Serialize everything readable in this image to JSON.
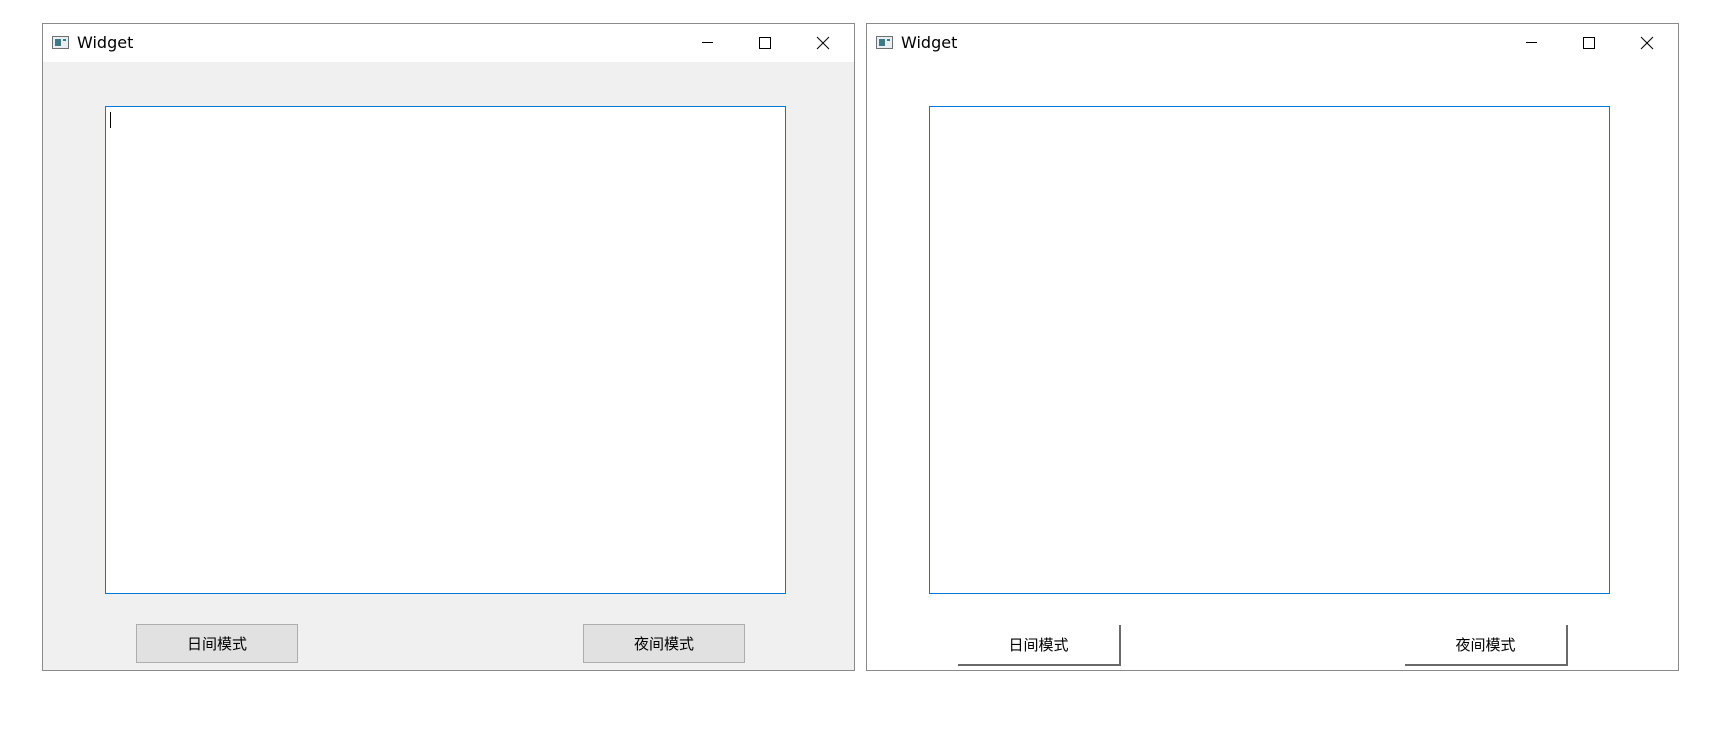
{
  "windows": [
    {
      "title": "Widget",
      "theme": "day",
      "client_background": "#f0f0f0",
      "text_edit": {
        "value": ""
      },
      "buttons": {
        "day_label": "日间模式",
        "night_label": "夜间模式"
      }
    },
    {
      "title": "Widget",
      "theme": "white",
      "client_background": "#ffffff",
      "text_edit": {
        "value": ""
      },
      "buttons": {
        "day_label": "日间模式",
        "night_label": "夜间模式"
      }
    }
  ],
  "icons": {
    "app": "app-window-icon",
    "minimize": "minimize-icon",
    "maximize": "maximize-icon",
    "close": "close-icon"
  },
  "colors": {
    "focus_border": "#0078d7",
    "button_face": "#e1e1e1"
  }
}
